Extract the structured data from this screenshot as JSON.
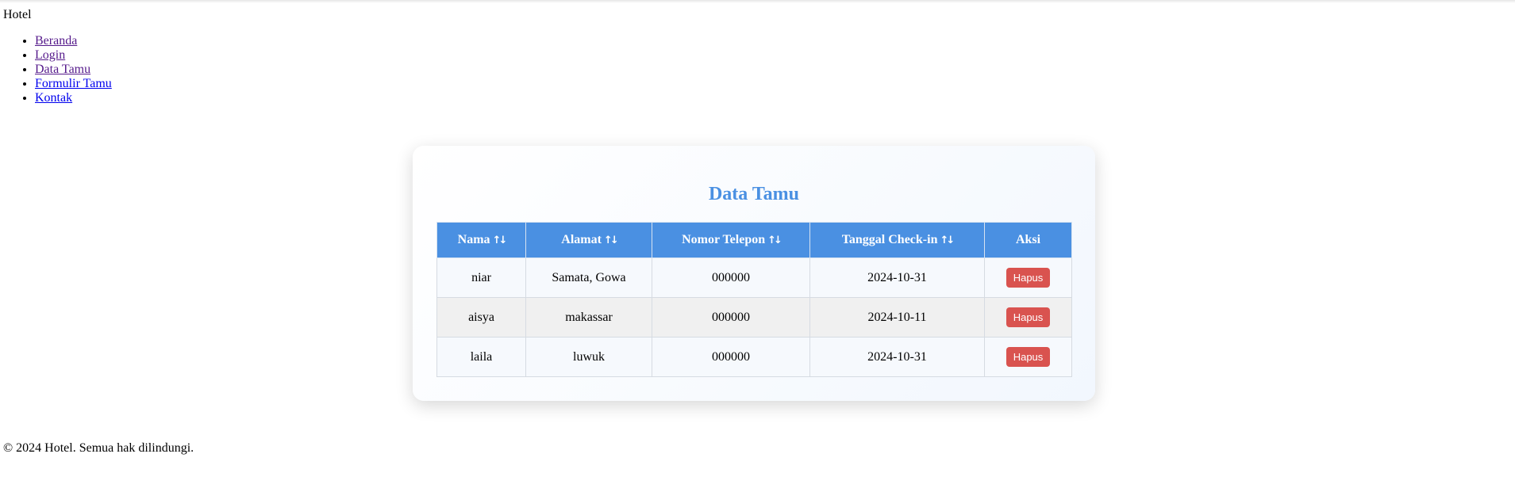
{
  "header": {
    "site_name": "Hotel"
  },
  "nav": {
    "items": [
      {
        "label": "Beranda",
        "visited": true
      },
      {
        "label": "Login",
        "visited": true
      },
      {
        "label": "Data Tamu",
        "visited": true
      },
      {
        "label": "Formulir Tamu",
        "visited": false
      },
      {
        "label": "Kontak",
        "visited": false
      }
    ]
  },
  "main": {
    "title": "Data Tamu",
    "table": {
      "columns": [
        {
          "label": "Nama",
          "sort_icon": "sort-arrows-icon"
        },
        {
          "label": "Alamat",
          "sort_icon": "sort-arrows-icon"
        },
        {
          "label": "Nomor Telepon",
          "sort_icon": "sort-arrows-icon"
        },
        {
          "label": "Tanggal Check-in",
          "sort_icon": "sort-arrows-icon"
        },
        {
          "label": "Aksi",
          "sort_icon": null
        }
      ],
      "rows": [
        {
          "nama": "niar",
          "alamat": "Samata, Gowa",
          "telepon": "000000",
          "checkin": "2024-10-31",
          "action_label": "Hapus"
        },
        {
          "nama": "aisya",
          "alamat": "makassar",
          "telepon": "000000",
          "checkin": "2024-10-11",
          "action_label": "Hapus"
        },
        {
          "nama": "laila",
          "alamat": "luwuk",
          "telepon": "000000",
          "checkin": "2024-10-31",
          "action_label": "Hapus"
        }
      ]
    }
  },
  "footer": {
    "text": "© 2024 Hotel. Semua hak dilindungi."
  },
  "colors": {
    "accent": "#4a90e2",
    "danger": "#d9534f",
    "link": "#0000ee",
    "link_visited": "#551a8b"
  }
}
